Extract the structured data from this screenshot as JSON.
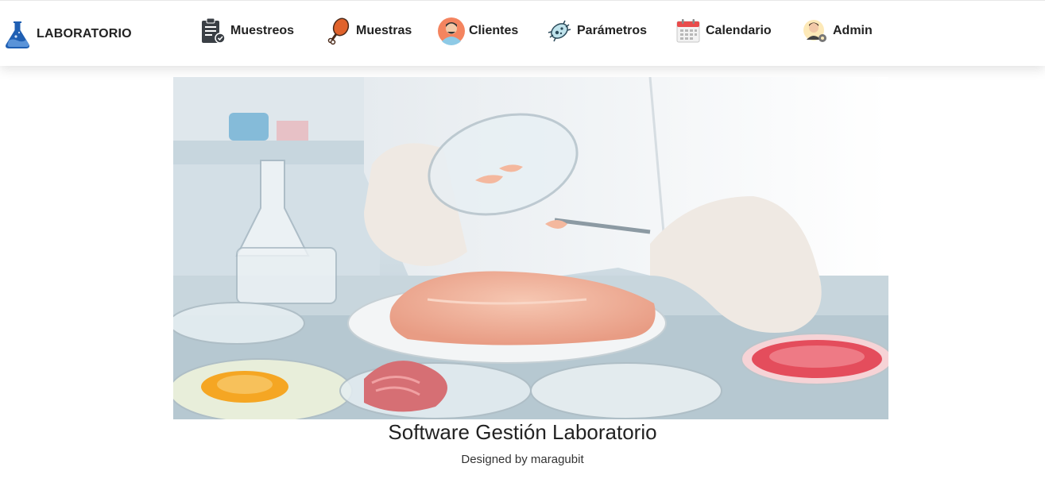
{
  "brand": {
    "label": "LABORATORIO",
    "icon": "flask-icon"
  },
  "nav": {
    "items": [
      {
        "label": "Muestreos",
        "icon": "clipboard-icon"
      },
      {
        "label": "Muestras",
        "icon": "drumstick-icon"
      },
      {
        "label": "Clientes",
        "icon": "user-avatar-icon"
      },
      {
        "label": "Parámetros",
        "icon": "bacteria-icon"
      },
      {
        "label": "Calendario",
        "icon": "calendar-icon"
      },
      {
        "label": "Admin",
        "icon": "admin-avatar-icon"
      }
    ]
  },
  "hero": {
    "image": "lab-food-sample-photo"
  },
  "main": {
    "title": "Software Gestión Laboratorio",
    "subtitle": "Designed by maragubit"
  },
  "colors": {
    "brand_blue": "#1f5fb3",
    "text": "#222222",
    "nav_shadow": "#e6e6e6"
  }
}
